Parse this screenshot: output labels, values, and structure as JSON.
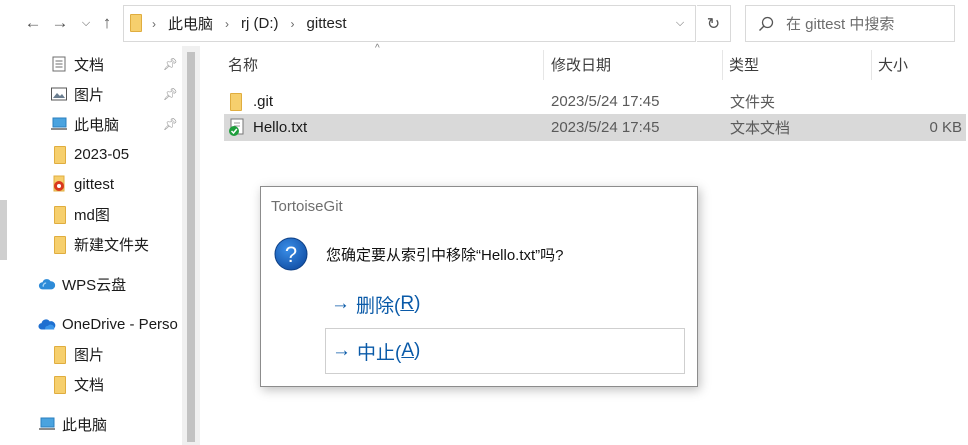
{
  "address_bar": {
    "path": [
      "此电脑",
      "rj (D:)",
      "gittest"
    ],
    "search_placeholder": "在 gittest 中搜索"
  },
  "sidebar": {
    "items": [
      {
        "label": "文档",
        "icon": "documents-icon",
        "pinned": true
      },
      {
        "label": "图片",
        "icon": "pictures-icon",
        "pinned": true
      },
      {
        "label": "此电脑",
        "icon": "this-pc-icon",
        "pinned": true
      },
      {
        "label": "2023-05",
        "icon": "folder-icon",
        "pinned": false
      },
      {
        "label": "gittest",
        "icon": "git-folder-icon",
        "pinned": false
      },
      {
        "label": "md图",
        "icon": "folder-icon",
        "pinned": false
      },
      {
        "label": "新建文件夹",
        "icon": "folder-icon",
        "pinned": false
      },
      {
        "label": "WPS云盘",
        "icon": "wps-cloud-icon",
        "pinned": false
      },
      {
        "label": "OneDrive - Perso",
        "icon": "onedrive-icon",
        "pinned": false
      },
      {
        "label": "图片",
        "icon": "folder-icon",
        "pinned": false
      },
      {
        "label": "文档",
        "icon": "folder-icon",
        "pinned": false
      },
      {
        "label": "此电脑",
        "icon": "this-pc-icon",
        "pinned": false
      }
    ]
  },
  "file_list": {
    "columns": [
      "名称",
      "修改日期",
      "类型",
      "大小"
    ],
    "rows": [
      {
        "name": ".git",
        "modified": "2023/5/24 17:45",
        "type": "文件夹",
        "size": ""
      },
      {
        "name": "Hello.txt",
        "modified": "2023/5/24 17:45",
        "type": "文本文档",
        "size": "0 KB"
      }
    ]
  },
  "dialog": {
    "title": "TortoiseGit",
    "message": "您确定要从索引中移除“Hello.txt”吗?",
    "buttons": [
      {
        "arrow": "→",
        "label": "删除(",
        "key": "R",
        "suffix": ")"
      },
      {
        "arrow": "→",
        "label": "中止(",
        "key": "A",
        "suffix": ")"
      }
    ]
  },
  "colors": {
    "link_blue": "#0a5aa8",
    "selection": "#d9d9d9",
    "folder_yellow": "#f7d37b"
  }
}
